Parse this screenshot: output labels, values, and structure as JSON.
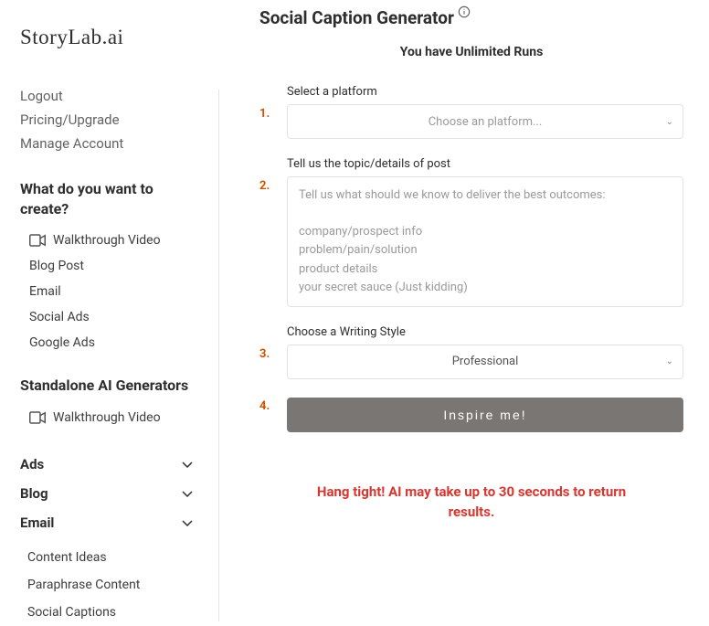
{
  "brand": "StoryLab.ai",
  "account_links": {
    "logout": "Logout",
    "pricing": "Pricing/Upgrade",
    "manage": "Manage Account"
  },
  "sidebar": {
    "create_heading": "What do you want to create?",
    "create_items": [
      {
        "label": "Walkthrough Video",
        "has_video_icon": true
      },
      {
        "label": "Blog Post"
      },
      {
        "label": "Email"
      },
      {
        "label": "Social Ads"
      },
      {
        "label": "Google Ads"
      }
    ],
    "standalone_heading": "Standalone AI Generators",
    "standalone_items": [
      {
        "label": "Walkthrough Video",
        "has_video_icon": true
      }
    ],
    "collapse_groups": [
      {
        "label": "Ads"
      },
      {
        "label": "Blog"
      },
      {
        "label": "Email"
      }
    ],
    "sub_links": [
      "Content Ideas",
      "Paraphrase Content",
      "Social Captions"
    ]
  },
  "main": {
    "title": "Social Caption Generator",
    "runs_text": "You have Unlimited Runs",
    "steps": {
      "s1_num": "1.",
      "s1_label": "Select a platform",
      "s1_placeholder": "Choose an platform...",
      "s2_num": "2.",
      "s2_label": "Tell us the topic/details of post",
      "s2_placeholder": "Tell us what should we know to deliver the best outcomes:\n\ncompany/prospect info\nproblem/pain/solution\nproduct details\nyour secret sauce (Just kidding)",
      "s3_num": "3.",
      "s3_label": "Choose a Writing Style",
      "s3_value": "Professional",
      "s4_num": "4.",
      "s4_button": "Inspire me!"
    },
    "wait_msg": "Hang tight! AI may take up to 30 seconds to return results."
  }
}
